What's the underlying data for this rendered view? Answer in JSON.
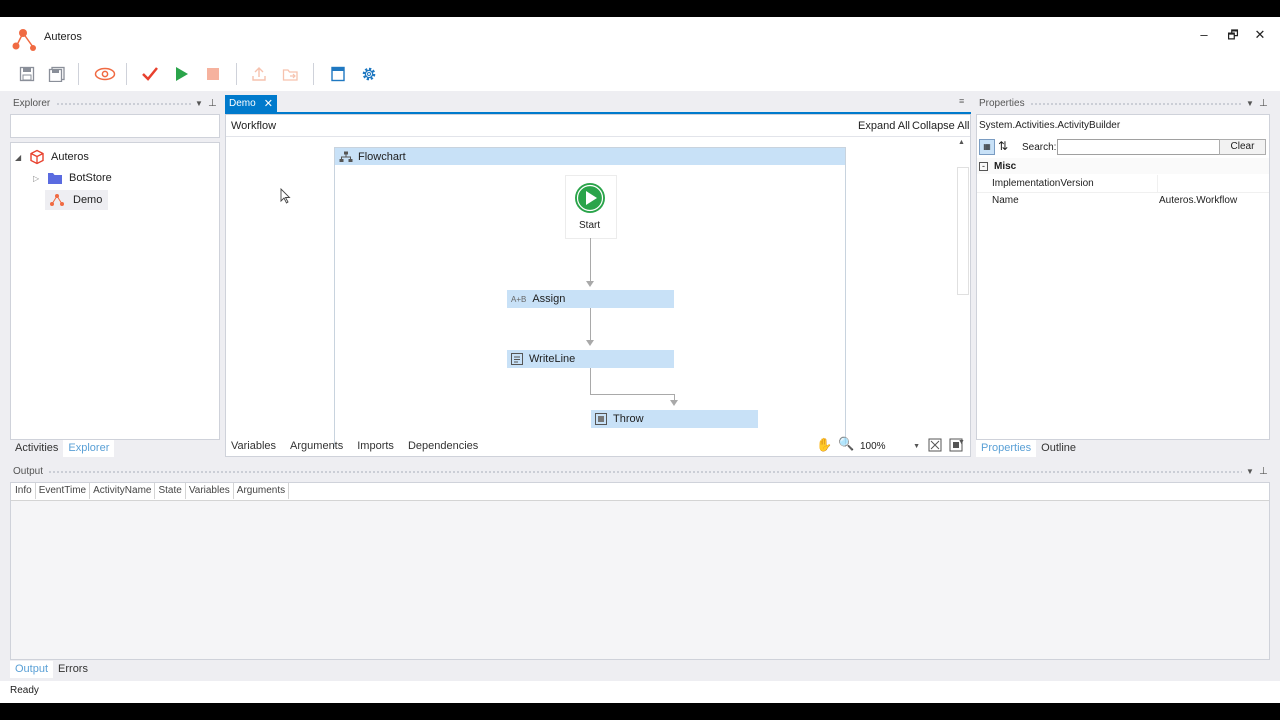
{
  "app": {
    "title": "Auteros",
    "status": "Ready"
  },
  "window": {
    "minimize": "–",
    "restore": "🗗",
    "close": "✕"
  },
  "explorer": {
    "title": "Explorer",
    "search_value": "",
    "tree": [
      {
        "label": "Auteros",
        "icon": "package-icon"
      },
      {
        "label": "BotStore",
        "icon": "folder-icon"
      },
      {
        "label": "Demo",
        "icon": "workflow-icon"
      }
    ],
    "tabs": [
      "Activities",
      "Explorer"
    ]
  },
  "designer": {
    "tab_label": "Demo",
    "breadcrumb": "Workflow",
    "expand_all": "Expand All",
    "collapse_all": "Collapse All",
    "flowchart_label": "Flowchart",
    "start_label": "Start",
    "nodes": {
      "assign": "Assign",
      "writeline": "WriteLine",
      "throw": "Throw"
    },
    "bottom_tabs": [
      "Variables",
      "Arguments",
      "Imports",
      "Dependencies"
    ],
    "zoom": "100%"
  },
  "properties": {
    "title": "Properties",
    "type_name": "System.Activities.ActivityBuilder",
    "search_label": "Search:",
    "search_value": "",
    "clear_label": "Clear",
    "category": "Misc",
    "rows": [
      {
        "name": "ImplementationVersion",
        "value": ""
      },
      {
        "name": "Name",
        "value": "Auteros.Workflow"
      }
    ],
    "tabs": [
      "Properties",
      "Outline"
    ]
  },
  "output": {
    "title": "Output",
    "columns": [
      "Info",
      "EventTime",
      "ActivityName",
      "State",
      "Variables",
      "Arguments"
    ],
    "tabs": [
      "Output",
      "Errors"
    ]
  },
  "colors": {
    "accent": "#007acc",
    "node_fill": "#c8e1f7",
    "play_green": "#2aa44a",
    "logo": "#f06a42"
  }
}
